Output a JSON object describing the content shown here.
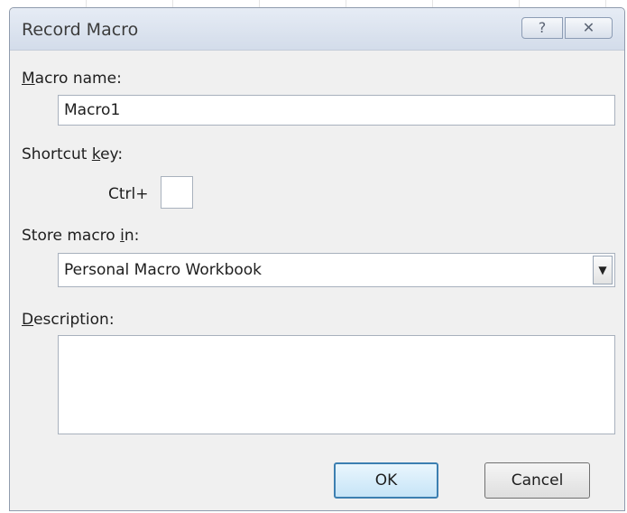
{
  "dialog": {
    "title": "Record Macro",
    "help_icon": "question-mark-icon",
    "close_icon": "close-x-icon",
    "help_glyph": "?",
    "close_glyph": "✕"
  },
  "macro_name": {
    "label_first": "M",
    "label_rest": "acro name:",
    "value": "Macro1"
  },
  "shortcut": {
    "label_pre": "Shortcut ",
    "label_u": "k",
    "label_post": "ey:",
    "ctrl_label": "Ctrl+",
    "value": ""
  },
  "store": {
    "label_pre": "Store macro ",
    "label_u": "i",
    "label_post": "n:",
    "selected": "Personal Macro Workbook",
    "arrow_glyph": "▼"
  },
  "description": {
    "label_first": "D",
    "label_rest": "escription:",
    "value": ""
  },
  "buttons": {
    "ok": "OK",
    "cancel": "Cancel"
  }
}
